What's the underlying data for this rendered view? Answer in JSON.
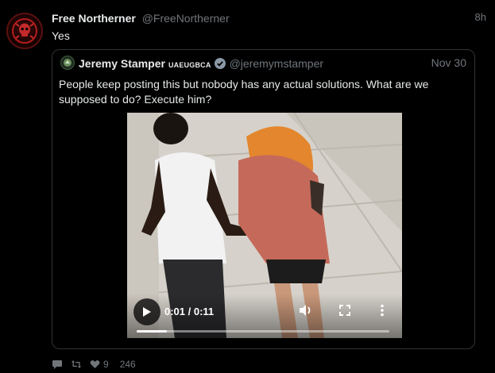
{
  "post": {
    "author_name": "Free Northerner",
    "author_handle": "@FreeNortherner",
    "time": "8h",
    "text": "Yes"
  },
  "quote": {
    "author_name": "Jeremy Stamper",
    "author_badge": "UAEUGBCA",
    "author_handle": "@jeremymstamper",
    "time": "Nov 30",
    "text": "People keep posting this but nobody has any actual solutions. What are we supposed to do? Execute him?"
  },
  "video": {
    "time_readout": "0:01 / 0:11",
    "progress_fraction": 0.12
  },
  "actions": {
    "likes": "9",
    "views": "246"
  },
  "colors": {
    "background": "#000000",
    "text": "#e7e9ea",
    "muted": "#71767b",
    "border": "#2f3336"
  },
  "icons": [
    "reply-icon",
    "retweet-icon",
    "like-icon",
    "play-icon",
    "volume-icon",
    "fullscreen-icon",
    "more-icon",
    "verified-icon"
  ]
}
